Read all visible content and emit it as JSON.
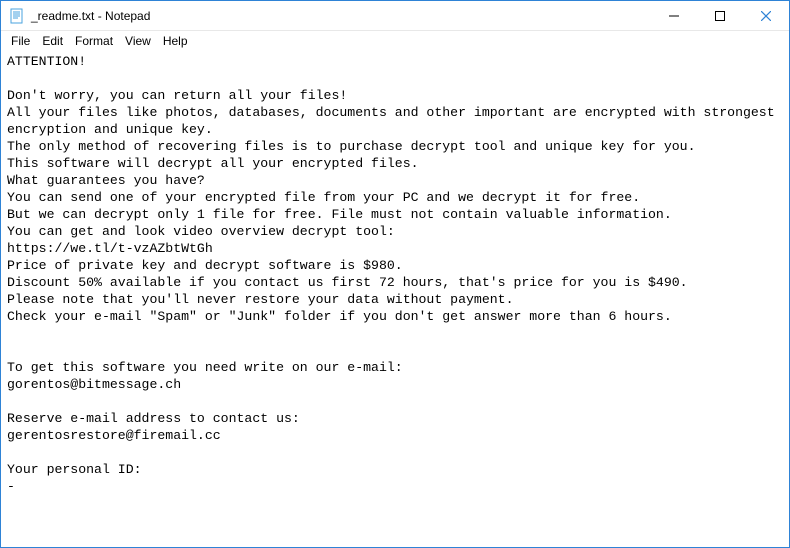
{
  "window": {
    "title": "_readme.txt - Notepad"
  },
  "menu": {
    "file": "File",
    "edit": "Edit",
    "format": "Format",
    "view": "View",
    "help": "Help"
  },
  "body": {
    "text": "ATTENTION!\n\nDon't worry, you can return all your files!\nAll your files like photos, databases, documents and other important are encrypted with strongest encryption and unique key.\nThe only method of recovering files is to purchase decrypt tool and unique key for you.\nThis software will decrypt all your encrypted files.\nWhat guarantees you have?\nYou can send one of your encrypted file from your PC and we decrypt it for free.\nBut we can decrypt only 1 file for free. File must not contain valuable information.\nYou can get and look video overview decrypt tool:\nhttps://we.tl/t-vzAZbtWtGh\nPrice of private key and decrypt software is $980.\nDiscount 50% available if you contact us first 72 hours, that's price for you is $490.\nPlease note that you'll never restore your data without payment.\nCheck your e-mail \"Spam\" or \"Junk\" folder if you don't get answer more than 6 hours.\n\n\nTo get this software you need write on our e-mail:\ngorentos@bitmessage.ch\n\nReserve e-mail address to contact us:\ngerentosrestore@firemail.cc\n\nYour personal ID:\n-"
  }
}
